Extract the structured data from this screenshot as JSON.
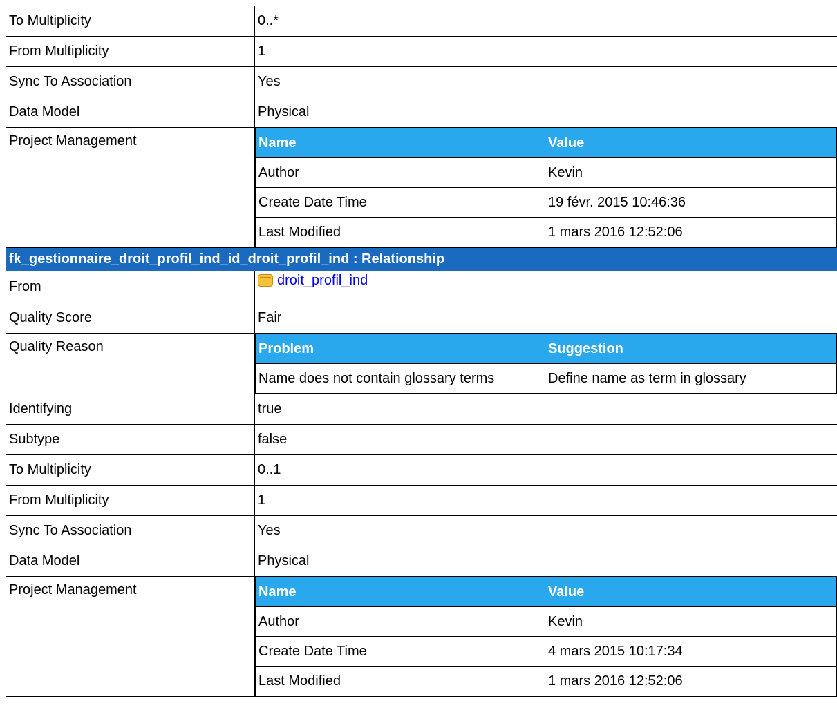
{
  "rows_top": [
    {
      "label": "To Multiplicity",
      "value": "0..*"
    },
    {
      "label": "From Multiplicity",
      "value": "1"
    },
    {
      "label": "Sync To Association",
      "value": "Yes"
    },
    {
      "label": "Data Model",
      "value": "Physical"
    }
  ],
  "pm1": {
    "label": "Project Management",
    "headers": {
      "name": "Name",
      "value": "Value"
    },
    "rows": [
      {
        "name": "Author",
        "value": "Kevin"
      },
      {
        "name": "Create Date Time",
        "value": "19 févr. 2015 10:46:36"
      },
      {
        "name": "Last Modified",
        "value": "1 mars 2016 12:52:06"
      }
    ]
  },
  "section": {
    "title": "fk_gestionnaire_droit_profil_ind_id_droit_profil_ind : Relationship",
    "header_color": "#1a6abf"
  },
  "from": {
    "label": "From",
    "link_text": "droit_profil_ind",
    "icon": "table-icon"
  },
  "quality_score": {
    "label": "Quality Score",
    "value": "Fair"
  },
  "quality_reason": {
    "label": "Quality Reason",
    "headers": {
      "problem": "Problem",
      "suggestion": "Suggestion"
    },
    "rows": [
      {
        "problem": "Name does not contain glossary terms",
        "suggestion": "Define name as term in glossary"
      }
    ]
  },
  "rows_bottom": [
    {
      "label": "Identifying",
      "value": "true"
    },
    {
      "label": "Subtype",
      "value": "false"
    },
    {
      "label": "To Multiplicity",
      "value": "0..1"
    },
    {
      "label": "From Multiplicity",
      "value": "1"
    },
    {
      "label": "Sync To Association",
      "value": "Yes"
    },
    {
      "label": "Data Model",
      "value": "Physical"
    }
  ],
  "pm2": {
    "label": "Project Management",
    "headers": {
      "name": "Name",
      "value": "Value"
    },
    "rows": [
      {
        "name": "Author",
        "value": "Kevin"
      },
      {
        "name": "Create Date Time",
        "value": "4 mars 2015 10:17:34"
      },
      {
        "name": "Last Modified",
        "value": "1 mars 2016 12:52:06"
      }
    ]
  },
  "colors": {
    "nested_header": "#2aa8ee",
    "section_header": "#1a6abf",
    "link": "#0000ee"
  }
}
